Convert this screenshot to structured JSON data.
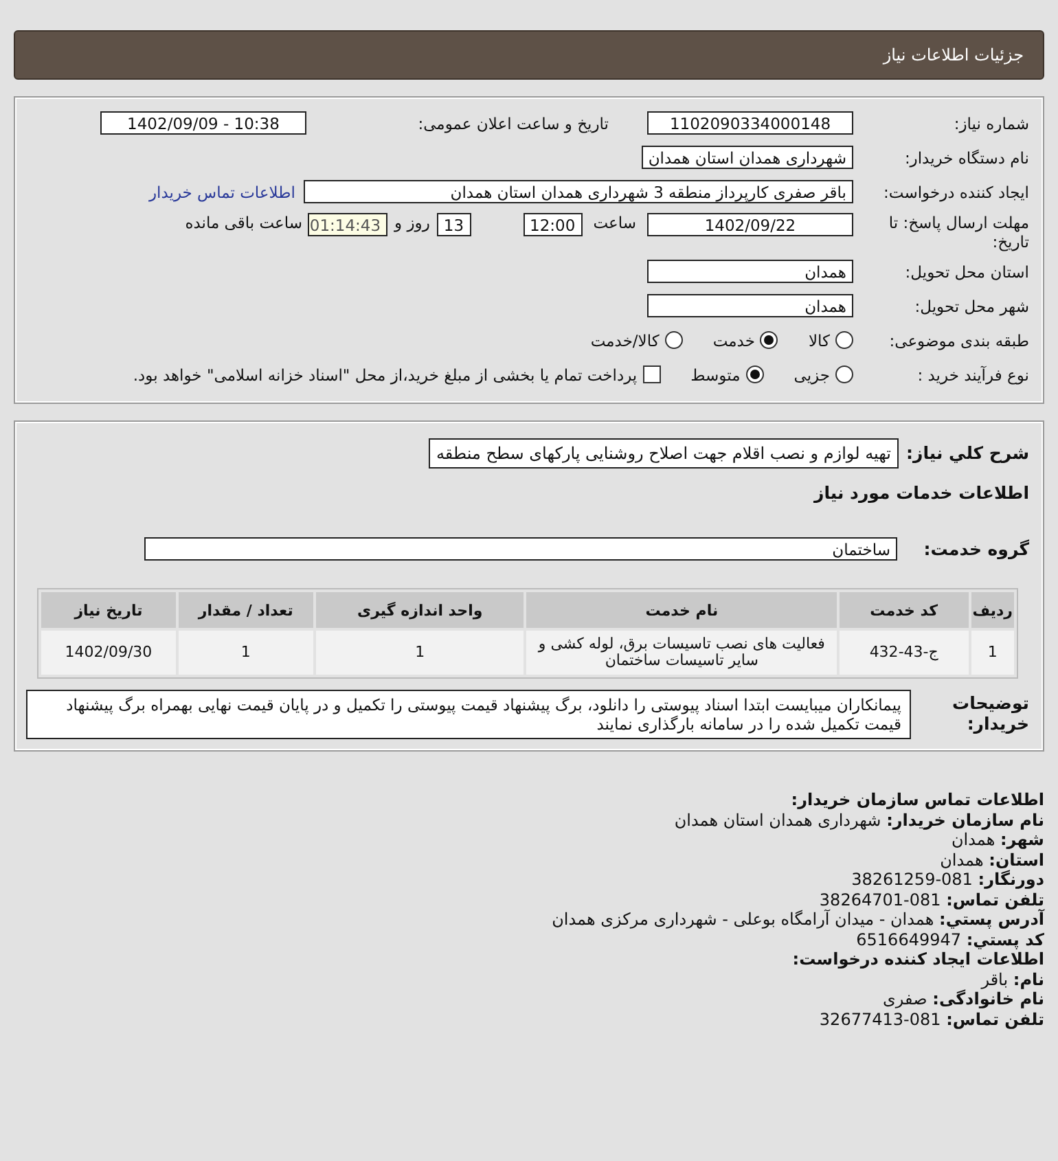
{
  "header": {
    "title": "جزئیات اطلاعات نیاز"
  },
  "need_number": {
    "label": "شماره نیاز:",
    "value": "1102090334000148"
  },
  "announce_datetime": {
    "label": "تاریخ و ساعت اعلان عمومی:",
    "value": "1402/09/09 - 10:38"
  },
  "buyer_org": {
    "label": "نام دستگاه خریدار:",
    "value": "شهرداری همدان استان همدان"
  },
  "requester": {
    "label": "ایجاد کننده درخواست:",
    "value": "باقر صفری کارپرداز منطقه 3 شهرداری همدان استان همدان",
    "link": "اطلاعات تماس خریدار"
  },
  "deadline": {
    "label": "مهلت ارسال پاسخ: تا تاریخ:",
    "date": "1402/09/22",
    "time_label": "ساعت",
    "time": "12:00",
    "days": "13",
    "days_label": "روز و",
    "remaining": "01:14:43",
    "remaining_label": "ساعت باقی مانده"
  },
  "delivery_province": {
    "label": "استان محل تحویل:",
    "value": "همدان"
  },
  "delivery_city": {
    "label": "شهر محل تحویل:",
    "value": "همدان"
  },
  "category": {
    "label": "طبقه بندی موضوعی:",
    "options": [
      {
        "label": "کالا",
        "selected": false
      },
      {
        "label": "خدمت",
        "selected": true
      },
      {
        "label": "کالا/خدمت",
        "selected": false
      }
    ]
  },
  "purchase_process": {
    "label": "نوع فرآیند خرید :",
    "options": [
      {
        "label": "جزیی",
        "selected": false
      },
      {
        "label": "متوسط",
        "selected": true
      }
    ],
    "checkbox": {
      "label": "پرداخت تمام یا بخشی از مبلغ خرید،از محل \"اسناد خزانه اسلامی\" خواهد بود.",
      "checked": false
    }
  },
  "summary": {
    "label": "شرح کلي نیاز:",
    "value": "تهیه لوازم و نصب اقلام جهت اصلاح روشنایی پارکهای سطح منطقه"
  },
  "services_heading": "اطلاعات خدمات مورد نیاز",
  "service_group": {
    "label": "گروه خدمت:",
    "value": "ساختمان"
  },
  "table": {
    "columns": [
      "ردیف",
      "کد خدمت",
      "نام خدمت",
      "واحد اندازه گیری",
      "تعداد / مقدار",
      "تاریخ نیاز"
    ],
    "rows": [
      [
        "1",
        "ج-43-432",
        "فعالیت های نصب تاسیسات برق، لوله کشی و سایر تاسیسات ساختمان",
        "1",
        "1",
        "1402/09/30"
      ]
    ]
  },
  "buyer_notes": {
    "label": "توضیحات خریدار:",
    "value": "پیمانکاران میبایست ابتدا اسناد پیوستی را دانلود، برگ پیشنهاد قیمت پیوستی را تکمیل و در پایان قیمت نهایی بهمراه برگ پیشنهاد قیمت تکمیل شده را در سامانه بارگذاری نمایند"
  },
  "contact": [
    {
      "kind": "heading",
      "text": "اطلاعات تماس سازمان خریدار:"
    },
    {
      "kind": "pair",
      "label": "نام سازمان خریدار:",
      "value": "شهرداری همدان استان همدان"
    },
    {
      "kind": "pair",
      "label": "شهر:",
      "value": "همدان"
    },
    {
      "kind": "pair",
      "label": "استان:",
      "value": "همدان"
    },
    {
      "kind": "pair",
      "label": "دورنگار:",
      "value": "38261259-081"
    },
    {
      "kind": "pair",
      "label": "تلفن تماس:",
      "value": "38264701-081"
    },
    {
      "kind": "pair",
      "label": "آدرس پستي:",
      "value": "همدان - میدان آرامگاه بوعلی - شهرداری مرکزی همدان"
    },
    {
      "kind": "pair",
      "label": "کد پستي:",
      "value": "6516649947"
    },
    {
      "kind": "heading",
      "text": "اطلاعات ایجاد کننده درخواست:"
    },
    {
      "kind": "pair",
      "label": "نام:",
      "value": "باقر"
    },
    {
      "kind": "pair",
      "label": "نام خانوادگی:",
      "value": "صفری"
    },
    {
      "kind": "pair",
      "label": "تلفن تماس:",
      "value": "32677413-081"
    }
  ]
}
